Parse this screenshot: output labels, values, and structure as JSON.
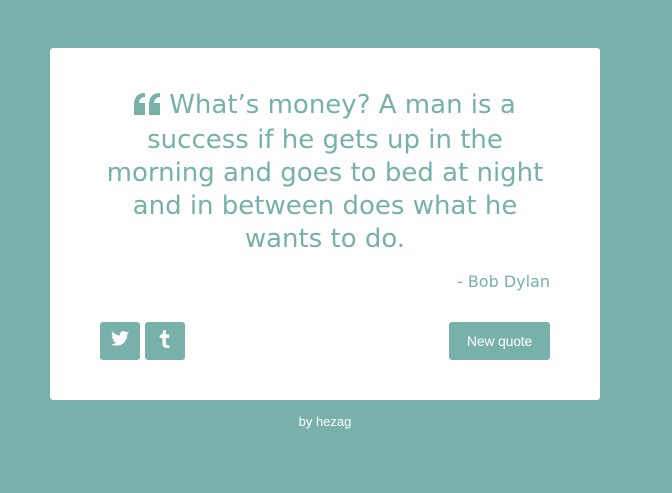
{
  "quote": {
    "text": "What’s money? A man is a success if he gets up in the morning and goes to bed at night and in between does what he wants to do.",
    "author": "- Bob Dylan",
    "quote_icon": "quote-left-icon"
  },
  "actions": {
    "twitter_icon": "twitter-icon",
    "tumblr_icon": "tumblr-icon",
    "new_quote_label": "New quote"
  },
  "footer": {
    "credit": "by hezag"
  },
  "colors": {
    "background": "#77b1a9",
    "card": "#ffffff",
    "accent": "#77b1a9"
  }
}
